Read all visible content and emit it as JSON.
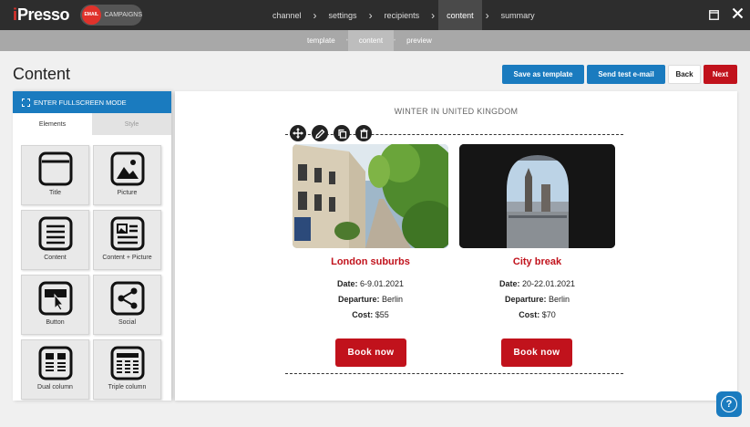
{
  "app": {
    "logo_i": "i",
    "logo_text": "Presso",
    "module_badge": "EMAIL",
    "module_label": "CAMPAIGNS"
  },
  "steps": [
    {
      "label": "channel",
      "active": false
    },
    {
      "label": "settings",
      "active": false
    },
    {
      "label": "recipients",
      "active": false
    },
    {
      "label": "content",
      "active": true
    },
    {
      "label": "summary",
      "active": false
    }
  ],
  "substeps": [
    {
      "label": "template",
      "active": false
    },
    {
      "label": "content",
      "active": true
    },
    {
      "label": "preview",
      "active": false
    }
  ],
  "page": {
    "title": "Content"
  },
  "actions": {
    "save_template": "Save as template",
    "send_test": "Send test e-mail",
    "back": "Back",
    "next": "Next"
  },
  "sidebar": {
    "fullscreen_label": "ENTER FULLSCREEN MODE",
    "tabs": [
      "Elements",
      "Style"
    ],
    "tiles": [
      {
        "label": "Title",
        "icon": "title-block-icon"
      },
      {
        "label": "Picture",
        "icon": "picture-block-icon"
      },
      {
        "label": "Content",
        "icon": "content-block-icon"
      },
      {
        "label": "Content + Picture",
        "icon": "content-picture-block-icon"
      },
      {
        "label": "Button",
        "icon": "button-block-icon"
      },
      {
        "label": "Social",
        "icon": "social-share-icon"
      },
      {
        "label": "Dual column",
        "icon": "dual-column-icon"
      },
      {
        "label": "Triple column",
        "icon": "triple-column-icon"
      }
    ]
  },
  "email": {
    "heading": "WINTER IN UNITED KINGDOM",
    "cards": [
      {
        "title": "London suburbs",
        "date_label": "Date:",
        "date": "6-9.01.2021",
        "departure_label": "Departure:",
        "departure": "Berlin",
        "cost_label": "Cost:",
        "cost": "$55",
        "button": "Book now"
      },
      {
        "title": "City break",
        "date_label": "Date:",
        "date": "20-22.01.2021",
        "departure_label": "Departure:",
        "departure": "Berlin",
        "cost_label": "Cost:",
        "cost": "$70",
        "button": "Book now"
      }
    ]
  },
  "colors": {
    "accent_blue": "#1a7bbf",
    "brand_red": "#c1121c",
    "topbar": "#2d2d2d"
  }
}
